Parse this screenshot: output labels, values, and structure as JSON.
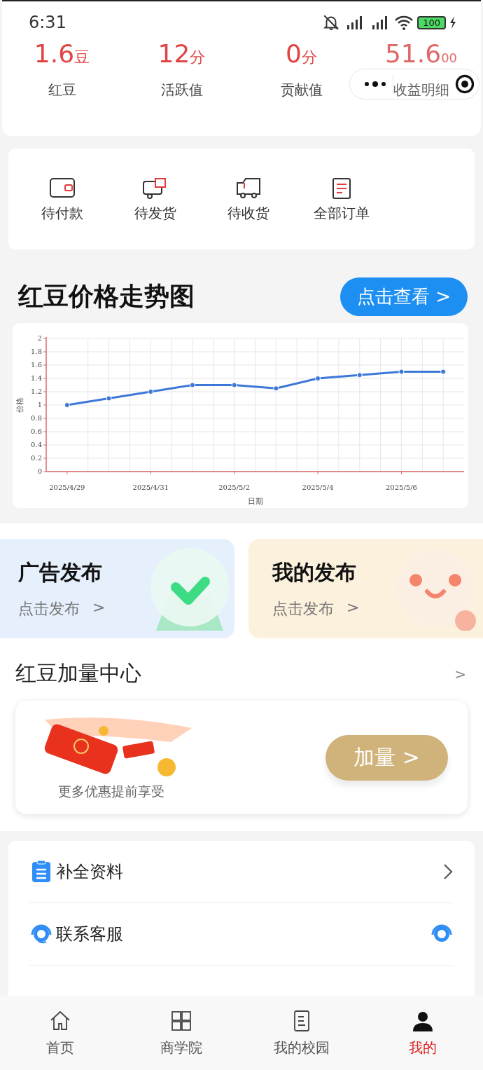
{
  "status_bar": {
    "time": "6:31",
    "battery": "100"
  },
  "stats": [
    {
      "value": "1.6",
      "unit": "豆",
      "label": "红豆"
    },
    {
      "value": "12",
      "unit": "分",
      "label": "活跃值"
    },
    {
      "value": "0",
      "unit": "分",
      "label": "贡献值"
    },
    {
      "value": "51.6",
      "unit": "00",
      "label": "收益明细"
    }
  ],
  "orders": [
    {
      "kind": "wallet",
      "label": "待付款"
    },
    {
      "kind": "ship",
      "label": "待发货"
    },
    {
      "kind": "truck",
      "label": "待收货"
    },
    {
      "kind": "list",
      "label": "全部订单"
    }
  ],
  "trend": {
    "title": "红豆价格走势图",
    "button": "点击查看  >",
    "chart_data": {
      "type": "line",
      "xlabel": "日期",
      "ylabel": "价格",
      "categories": [
        "2025/4/29",
        null,
        "2025/4/31",
        null,
        "2025/5/2",
        null,
        "2025/5/4",
        null,
        "2025/5/6",
        null
      ],
      "ylim": [
        0,
        2
      ],
      "yticks": [
        0,
        0.2,
        0.4,
        0.6,
        0.8,
        1,
        1.2,
        1.4,
        1.6,
        1.8,
        2
      ],
      "grid": true,
      "series": [
        {
          "color": "#3d78d8",
          "marker": true,
          "values": [
            1.0,
            1.1,
            1.2,
            1.3,
            1.3,
            1.25,
            1.4,
            1.45,
            1.5,
            1.5
          ]
        }
      ]
    }
  },
  "promos": [
    {
      "kind": "ad",
      "title": "广告发布",
      "subtitle": "点击发布",
      "arrow": ">"
    },
    {
      "kind": "mine",
      "title": "我的发布",
      "subtitle": "点击发布",
      "arrow": ">"
    }
  ],
  "boost": {
    "title": "红豆加量中心",
    "more": ">",
    "caption": "更多优惠提前享受",
    "button": "加量  >"
  },
  "menu": [
    {
      "kind": "profile",
      "label": "补全资料"
    },
    {
      "kind": "service",
      "label": "联系客服"
    }
  ],
  "tabs": [
    {
      "kind": "home",
      "label": "首页",
      "selected": false
    },
    {
      "kind": "grid",
      "label": "商学院",
      "selected": false
    },
    {
      "kind": "doc",
      "label": "我的校园",
      "selected": false
    },
    {
      "kind": "person",
      "label": "我的",
      "selected": true
    }
  ]
}
